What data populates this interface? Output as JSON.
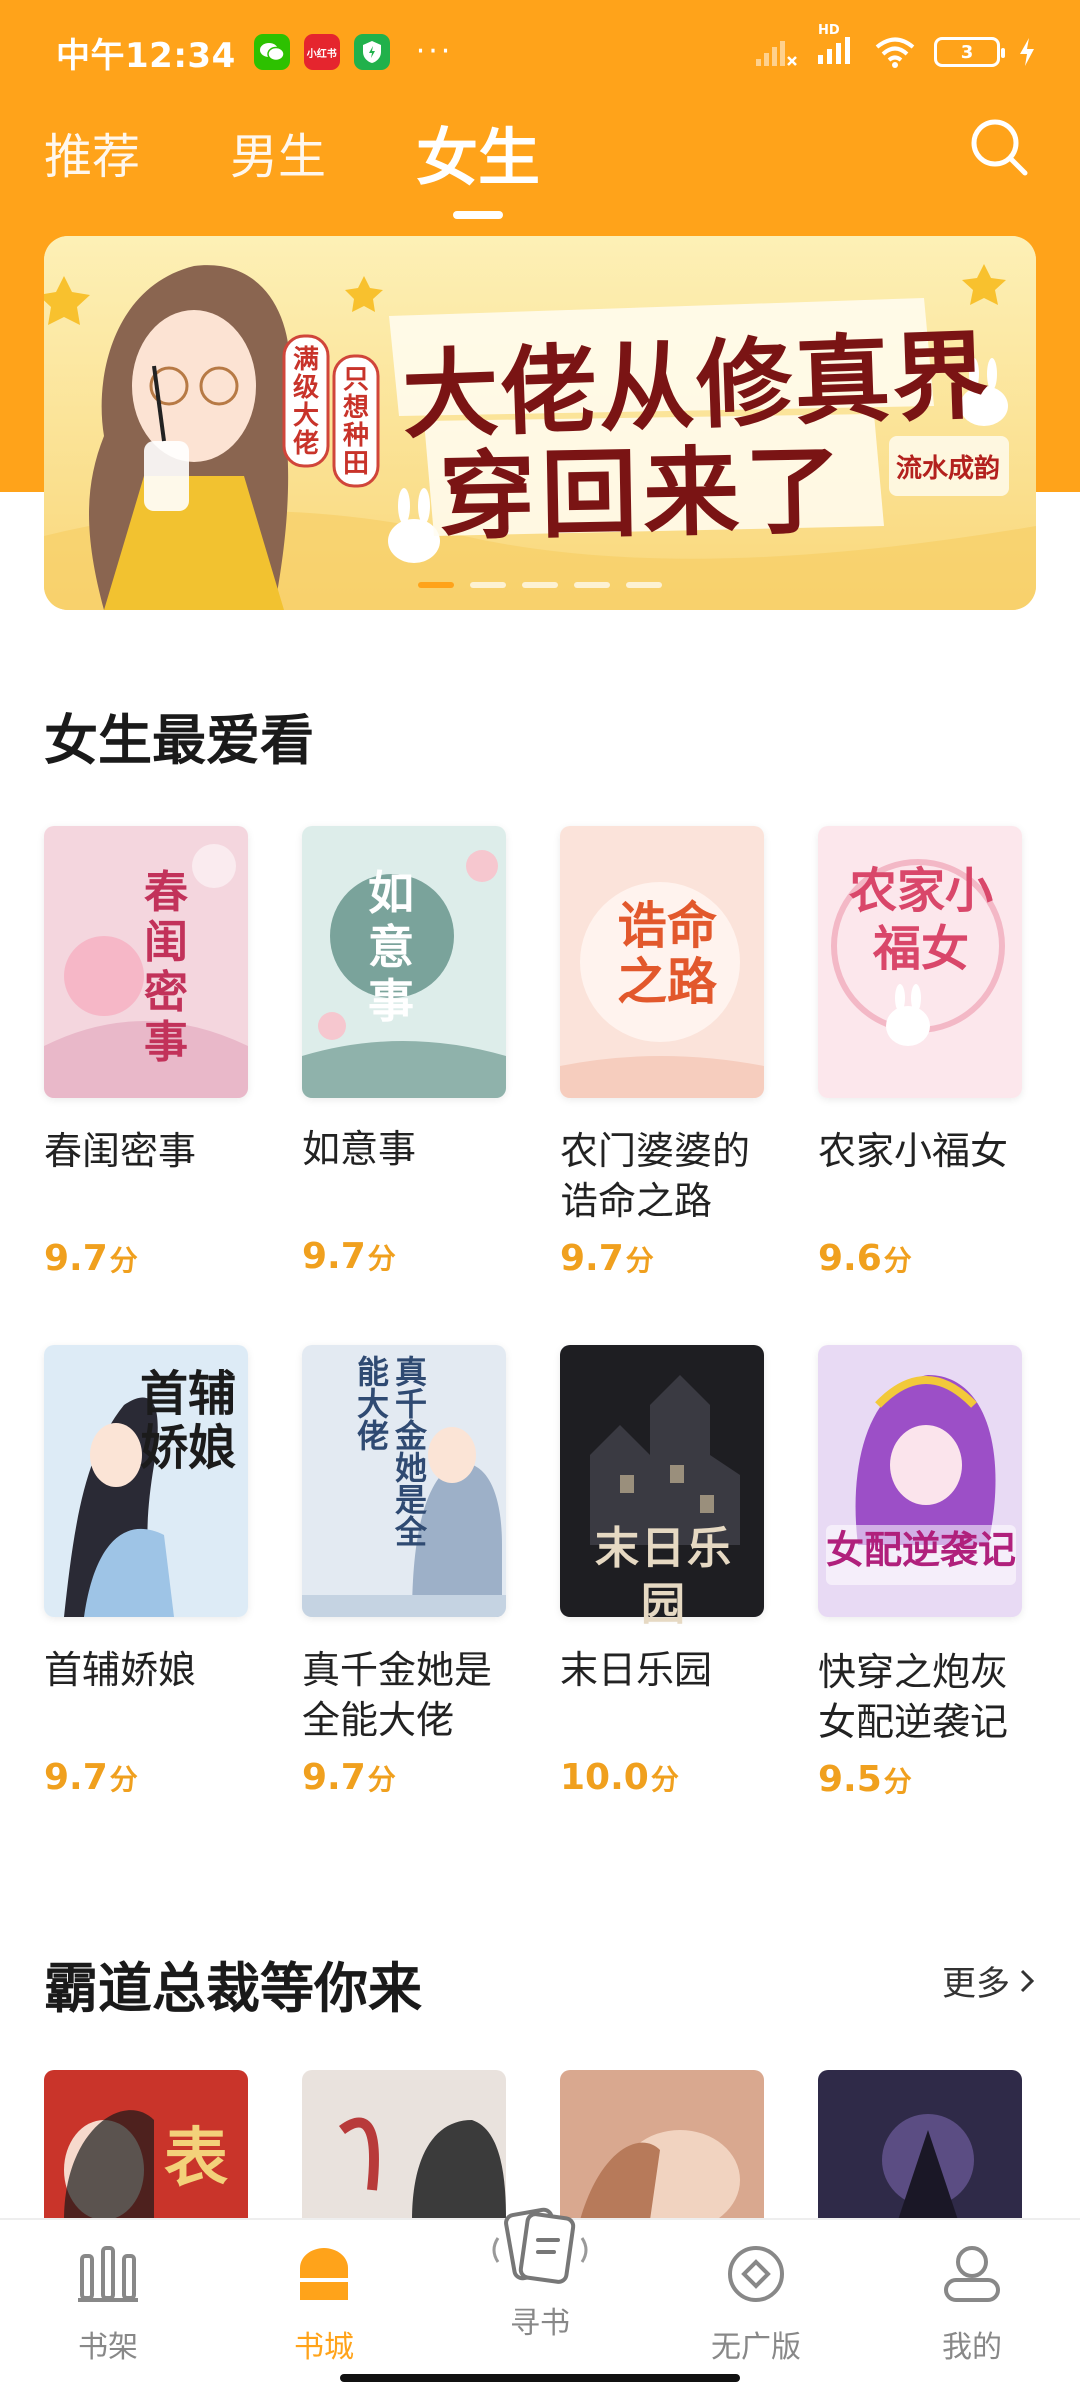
{
  "status_bar": {
    "time": "中午12:34",
    "apps": [
      {
        "icon": "wechat-icon",
        "label": "",
        "color": "#2DC100"
      },
      {
        "icon": "xiaohongshu-icon",
        "label": "小红书",
        "color": "#E5252E"
      },
      {
        "icon": "shield-app-icon",
        "label": "",
        "color": "#21B14B"
      }
    ],
    "more": "···",
    "signal_label": "HD",
    "battery": "3"
  },
  "top_tabs": [
    {
      "label": "推荐",
      "active": false
    },
    {
      "label": "男生",
      "active": false
    },
    {
      "label": "女生",
      "active": true
    }
  ],
  "banner": {
    "title_line1": "大佬从修真界",
    "title_line2": "穿回来了",
    "tagline_a": "满级大佬",
    "tagline_b": "只想种田",
    "author_stamp": "流水成韵",
    "pages": 5,
    "active_page": 1
  },
  "section1": {
    "title": "女生最爱看",
    "books": [
      {
        "title": "春闺密事",
        "score": "9.7",
        "unit": "分",
        "cover_text": "春闺密事",
        "cover_bg": "#F4D6DE",
        "cover_fg": "#C2325A"
      },
      {
        "title": "如意事",
        "score": "9.7",
        "unit": "分",
        "cover_text": "如意事",
        "cover_bg": "#DDEDEA",
        "cover_fg": "#3E6E68"
      },
      {
        "title": "农门婆婆的诰命之路",
        "score": "9.7",
        "unit": "分",
        "cover_text": "诰命之路",
        "cover_bg": "#FBE3DA",
        "cover_fg": "#E2582C"
      },
      {
        "title": "农家小福女",
        "score": "9.6",
        "unit": "分",
        "cover_text": "农家小福女",
        "cover_bg": "#FCE7EC",
        "cover_fg": "#D9476A"
      },
      {
        "title": "首辅娇娘",
        "score": "9.7",
        "unit": "分",
        "cover_text": "首辅娇娘",
        "cover_bg": "#DDEBF6",
        "cover_fg": "#1B1B1B"
      },
      {
        "title": "真千金她是全能大佬",
        "score": "9.7",
        "unit": "分",
        "cover_text": "真千金她是全能大佬",
        "cover_bg": "#E3EAF2",
        "cover_fg": "#2F4A72"
      },
      {
        "title": "末日乐园",
        "score": "10.0",
        "unit": "分",
        "cover_text": "末日乐园",
        "cover_bg": "#1E1E22",
        "cover_fg": "#E6D9C3"
      },
      {
        "title": "快穿之炮灰女配逆袭记",
        "score": "9.5",
        "unit": "分",
        "cover_text": "女配逆袭记",
        "cover_bg": "#E8DAF4",
        "cover_fg": "#B0207C"
      }
    ]
  },
  "section2": {
    "title": "霸道总裁等你来",
    "more_label": "更多",
    "covers": [
      {
        "color": "#C9342A"
      },
      {
        "color": "#E9E2DD"
      },
      {
        "color": "#D9A88F"
      },
      {
        "color": "#2F2A48"
      }
    ]
  },
  "bottom_nav": [
    {
      "label": "书架",
      "icon": "bookshelf-icon",
      "active": false
    },
    {
      "label": "书城",
      "icon": "bookstore-home-icon",
      "active": true
    },
    {
      "label": "寻书",
      "icon": "find-book-cards-icon",
      "active": false
    },
    {
      "label": "无广版",
      "icon": "ad-free-icon",
      "active": false
    },
    {
      "label": "我的",
      "icon": "profile-icon",
      "active": false
    }
  ],
  "colors": {
    "accent": "#FFA31A",
    "rating": "#F0A01E"
  }
}
